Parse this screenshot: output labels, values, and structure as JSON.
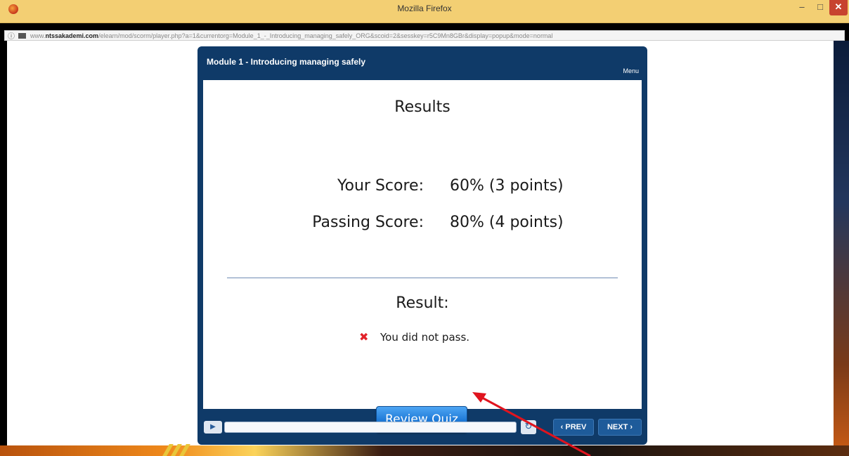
{
  "window": {
    "title": "Mozilla Firefox",
    "minimize": "–",
    "maximize": "□",
    "close": "✕"
  },
  "urlbar": {
    "info_icon": "ⓘ",
    "url_prefix": "www.",
    "url_domain": "ntssakademi.com",
    "url_path": "/elearn/mod/scorm/player.php?a=1&currentorg=Module_1_-_Introducing_managing_safely_ORG&scoid=2&sesskey=r5C9Mn8GBr&display=popup&mode=normal"
  },
  "player": {
    "module_title": "Module 1 - Introducing managing safely",
    "menu_label": "Menu",
    "slide": {
      "title": "Results",
      "your_score_label": "Your Score:",
      "your_score_value": "60% (3 points)",
      "passing_score_label": "Passing Score:",
      "passing_score_value": "80% (4 points)",
      "result_label": "Result:",
      "result_icon": "✖",
      "result_text": "You did not pass.",
      "review_button": "Review Quiz"
    },
    "controls": {
      "play_icon": "▶",
      "replay_icon": "↻",
      "prev_label": "‹ PREV",
      "next_label": "NEXT ›"
    }
  },
  "colors": {
    "titlebar": "#f3cf73",
    "player_frame": "#0f3a68",
    "fail_icon": "#e2222a",
    "review_button": "#1d78d6",
    "annotation_arrow": "#e0141e"
  }
}
